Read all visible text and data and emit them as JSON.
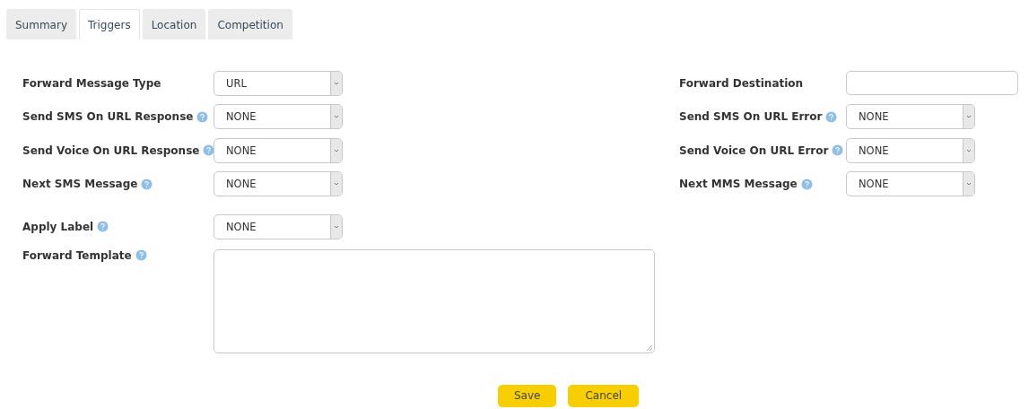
{
  "tabs": [
    {
      "label": "Summary",
      "selected": false
    },
    {
      "label": "Triggers",
      "selected": true
    },
    {
      "label": "Location",
      "selected": false
    },
    {
      "label": "Competition",
      "selected": false
    }
  ],
  "left_fields": [
    {
      "label": "Forward Message Type",
      "help": false,
      "kind": "select",
      "value": "URL"
    },
    {
      "label": "Send SMS On URL Response",
      "help": true,
      "kind": "select",
      "value": "NONE"
    },
    {
      "label": "Send Voice On URL Response",
      "help": true,
      "kind": "select",
      "value": "NONE"
    },
    {
      "label": "Next SMS Message",
      "help": true,
      "kind": "select",
      "value": "NONE"
    }
  ],
  "right_fields": [
    {
      "label": "Forward Destination",
      "help": false,
      "kind": "text"
    },
    {
      "label": "Send SMS On URL Error",
      "help": true,
      "kind": "select",
      "value": "NONE"
    },
    {
      "label": "Send Voice On URL Error",
      "help": true,
      "kind": "select",
      "value": "NONE"
    },
    {
      "label": "Next MMS Message",
      "help": true,
      "kind": "select",
      "value": "NONE"
    }
  ],
  "lower_fields": [
    {
      "label": "Apply Label",
      "help": true,
      "kind": "select",
      "value": "NONE"
    },
    {
      "label": "Forward Template",
      "help": true,
      "kind": "textarea"
    }
  ],
  "buttons": [
    "Save",
    "Cancel"
  ]
}
